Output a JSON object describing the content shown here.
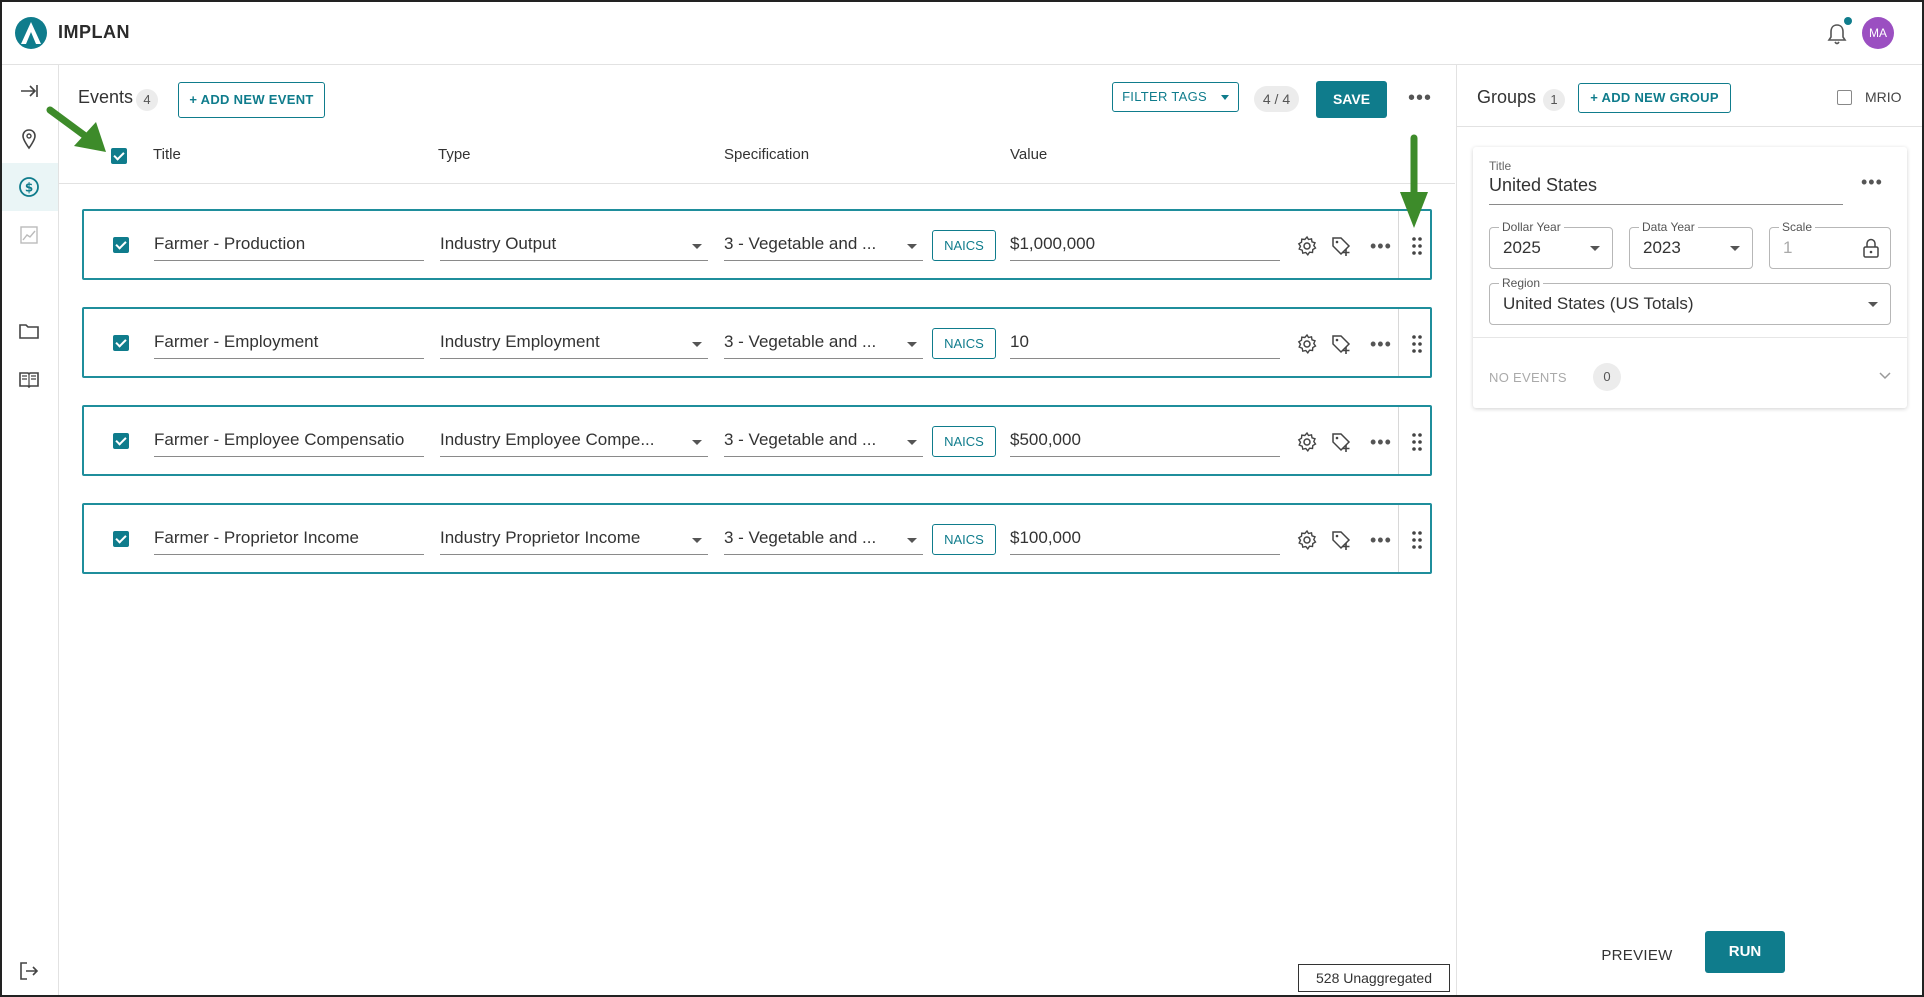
{
  "app": {
    "brand": "IMPLAN",
    "avatar_initials": "MA",
    "accent_color": "#0f7c8c"
  },
  "rail": {
    "items": [
      {
        "icon": "expand-arrow-icon"
      },
      {
        "icon": "location-pin-icon"
      },
      {
        "icon": "dollar-circle-icon",
        "active": true
      },
      {
        "icon": "chart-icon"
      },
      {
        "icon": "folder-icon"
      },
      {
        "icon": "book-icon"
      },
      {
        "icon": "logout-icon"
      }
    ]
  },
  "events": {
    "title": "Events",
    "count": "4",
    "add_label": "+ ADD NEW EVENT",
    "filter_label": "FILTER TAGS",
    "selection_count": "4 / 4",
    "save_label": "SAVE",
    "columns": {
      "title": "Title",
      "type": "Type",
      "specification": "Specification",
      "value": "Value"
    },
    "naics_label": "NAICS",
    "rows": [
      {
        "title": "Farmer - Production",
        "type": "Industry Output",
        "spec": "3 - Vegetable and ...",
        "value": "$1,000,000"
      },
      {
        "title": "Farmer - Employment",
        "type": "Industry Employment",
        "spec": "3 - Vegetable and ...",
        "value": "10"
      },
      {
        "title": "Farmer - Employee Compensatio",
        "type": "Industry Employee Compe...",
        "spec": "3 - Vegetable and ...",
        "value": "$500,000"
      },
      {
        "title": "Farmer - Proprietor Income",
        "type": "Industry Proprietor Income",
        "spec": "3 - Vegetable and ...",
        "value": "$100,000"
      }
    ]
  },
  "groups": {
    "title": "Groups",
    "count": "1",
    "add_label": "+ ADD NEW GROUP",
    "mrio_label": "MRIO",
    "card": {
      "title_label": "Title",
      "title_value": "United States",
      "dollar_year_label": "Dollar Year",
      "dollar_year": "2025",
      "data_year_label": "Data Year",
      "data_year": "2023",
      "scale_label": "Scale",
      "scale_value": "1",
      "region_label": "Region",
      "region_value": "United States (US Totals)",
      "no_events_label": "NO EVENTS",
      "no_events_count": "0"
    },
    "preview_label": "PREVIEW",
    "run_label": "RUN"
  },
  "status": {
    "unaggregated": "528 Unaggregated"
  },
  "annotations": {
    "arrow_color": "#3d8b2a"
  }
}
